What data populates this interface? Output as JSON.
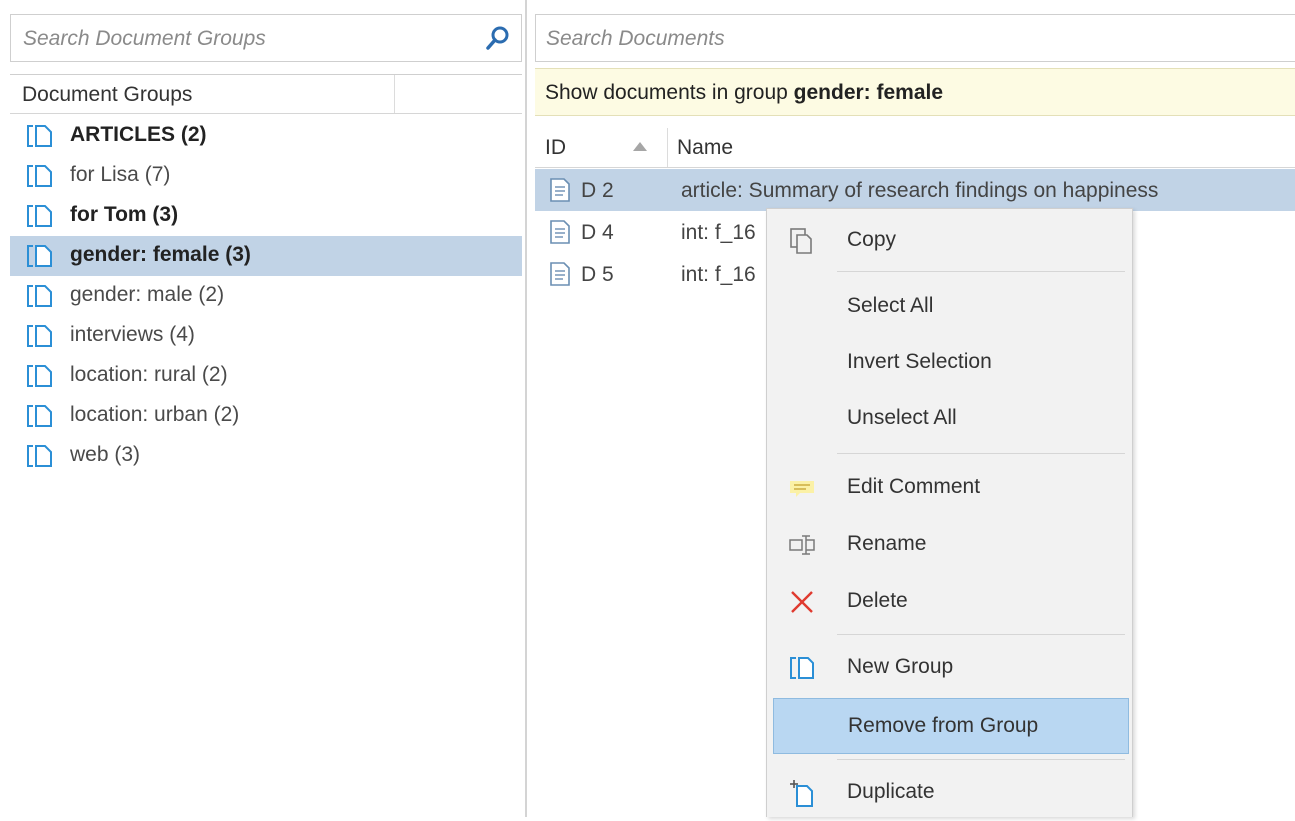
{
  "left": {
    "search_placeholder": "Search Document Groups",
    "header": "Document Groups",
    "groups": [
      {
        "label": "ARTICLES (2)",
        "bold": true,
        "selected": false
      },
      {
        "label": "for Lisa (7)",
        "bold": false,
        "selected": false
      },
      {
        "label": "for Tom (3)",
        "bold": true,
        "selected": false
      },
      {
        "label": "gender: female (3)",
        "bold": true,
        "selected": true
      },
      {
        "label": "gender: male (2)",
        "bold": false,
        "selected": false
      },
      {
        "label": "interviews (4)",
        "bold": false,
        "selected": false
      },
      {
        "label": "location: rural (2)",
        "bold": false,
        "selected": false
      },
      {
        "label": "location: urban (2)",
        "bold": false,
        "selected": false
      },
      {
        "label": "web (3)",
        "bold": false,
        "selected": false
      }
    ]
  },
  "right": {
    "search_placeholder": "Search Documents",
    "banner_prefix": "Show documents in group ",
    "banner_group": "gender: female",
    "columns": {
      "id": "ID",
      "name": "Name"
    },
    "rows": [
      {
        "id": "D 2",
        "name": "article: Summary of research findings on happiness",
        "selected": true
      },
      {
        "id": "D 4",
        "name": "int: f_16",
        "selected": false
      },
      {
        "id": "D 5",
        "name": "int: f_16",
        "selected": false
      }
    ]
  },
  "context_menu": {
    "items": {
      "copy": "Copy",
      "select_all": "Select All",
      "invert_selection": "Invert Selection",
      "unselect_all": "Unselect All",
      "edit_comment": "Edit Comment",
      "rename": "Rename",
      "delete": "Delete",
      "new_group": "New Group",
      "remove_from_group": "Remove from Group",
      "duplicate": "Duplicate"
    }
  },
  "colors": {
    "selection": "#c1d3e6",
    "menu_highlight": "#b9d7f2",
    "banner": "#fdfbe3",
    "group_icon": "#2b8fd6",
    "delete_icon": "#e03a2f"
  }
}
